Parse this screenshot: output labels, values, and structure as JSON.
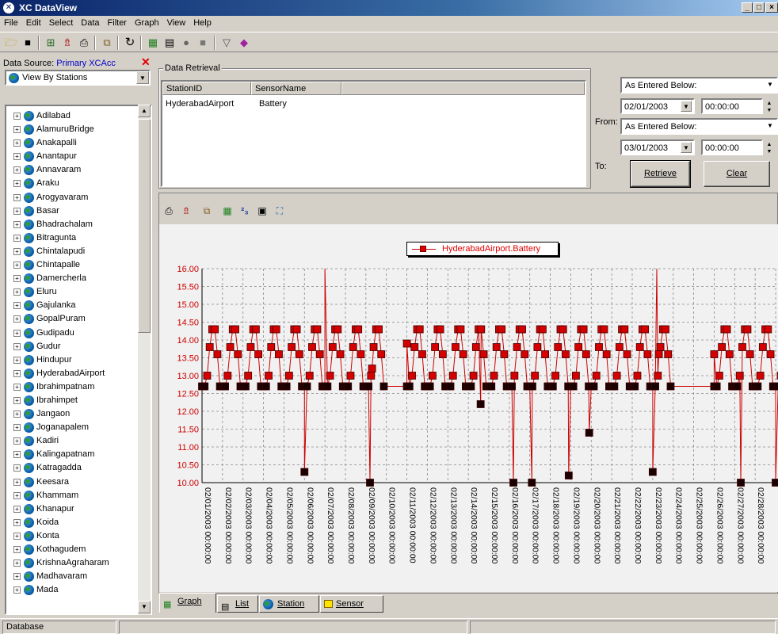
{
  "window": {
    "title": "XC DataView",
    "controls": [
      "_",
      "□",
      "×"
    ]
  },
  "menu": [
    "File",
    "Edit",
    "Select",
    "Data",
    "Filter",
    "Graph",
    "View",
    "Help"
  ],
  "toolbar_icons": [
    "open-folder-icon",
    "save-icon",
    "network-icon",
    "upload-icon",
    "print-icon",
    "copy-icon",
    "refresh-icon",
    "graph-icon",
    "list-icon",
    "record-icon",
    "stop-icon",
    "filter-icon",
    "eraser-icon"
  ],
  "left_panel": {
    "data_source_label": "Data Source:",
    "data_source_value": "Primary XCAcc",
    "view_select": "View By Stations",
    "stations": [
      "Adilabad",
      "AlamuruBridge",
      "Anakapalli",
      "Anantapur",
      "Annavaram",
      "Araku",
      "Arogyavaram",
      "Basar",
      "Bhadrachalam",
      "Bitragunta",
      "Chintalapudi",
      "Chintapalle",
      "Damercherla",
      "Eluru",
      "Gajulanka",
      "GopalPuram",
      "Gudipadu",
      "Gudur",
      "Hindupur",
      "HyderabadAirport",
      "Ibrahimpatnam",
      "Ibrahimpet",
      "Jangaon",
      "Joganapalem",
      "Kadiri",
      "Kalingapatnam",
      "Katragadda",
      "Keesara",
      "Khammam",
      "Khanapur",
      "Koida",
      "Konta",
      "Kothagudem",
      "KrishnaAgraharam",
      "Madhavaram",
      "Mada"
    ]
  },
  "retrieval": {
    "group_label": "Data Retrieval",
    "columns": [
      "StationID",
      "SensorName"
    ],
    "rows": [
      [
        "HyderabadAirport",
        "Battery"
      ]
    ],
    "from_label": "From:",
    "to_label": "To:",
    "from_mode": "As Entered Below:",
    "from_date": "02/01/2003",
    "from_time": "00:00:00",
    "to_mode": "As Entered Below:",
    "to_date": "03/01/2003",
    "to_time": "00:00:00",
    "retrieve_label": "Retrieve",
    "clear_label": "Clear"
  },
  "graph_toolbar_icons": [
    "print-icon",
    "upload-icon",
    "copy-icon",
    "graph-style-icon",
    "number-format-icon",
    "grid-icon",
    "chart-settings-icon"
  ],
  "chart_data": {
    "type": "line",
    "series": [
      {
        "name": "HyderabadAirport.Battery",
        "color": "#cc0000"
      }
    ],
    "legend": "top-center",
    "ylim": [
      10.0,
      16.0
    ],
    "yticks": [
      "16.00",
      "15.50",
      "15.00",
      "14.50",
      "14.00",
      "13.50",
      "13.00",
      "12.50",
      "12.00",
      "11.50",
      "11.00",
      "10.50",
      "10.00"
    ],
    "xticks": [
      "02/01/2003 00:00:00",
      "02/02/2003 00:00:00",
      "02/03/2003 00:00:00",
      "02/04/2003 00:00:00",
      "02/05/2003 00:00:00",
      "02/06/2003 00:00:00",
      "02/07/2003 00:00:00",
      "02/08/2003 00:00:00",
      "02/09/2003 00:00:00",
      "02/10/2003 00:00:00",
      "02/11/2003 00:00:00",
      "02/12/2003 00:00:00",
      "02/13/2003 00:00:00",
      "02/14/2003 00:00:00",
      "02/15/2003 00:00:00",
      "02/16/2003 00:00:00",
      "02/17/2003 00:00:00",
      "02/18/2003 00:00:00",
      "02/19/2003 00:00:00",
      "02/20/2003 00:00:00",
      "02/21/2003 00:00:00",
      "02/22/2003 00:00:00",
      "02/23/2003 00:00:00",
      "02/24/2003 00:00:00",
      "02/25/2003 00:00:00",
      "02/26/2003 00:00:00",
      "02/27/2003 00:00:00",
      "02/28/2003 00:00:00",
      "03/01/2003 00:00:00"
    ],
    "grid": true,
    "days_with_data": [
      0,
      1,
      2,
      3,
      4,
      5,
      6,
      7,
      8,
      10,
      11,
      12,
      13,
      14,
      15,
      16,
      17,
      18,
      19,
      20,
      21,
      22,
      25,
      26,
      27,
      28
    ],
    "daily_cycle": [
      12.7,
      13.0,
      13.8,
      14.3,
      13.6,
      12.7
    ],
    "gaps": [
      [
        8.3,
        10.0,
        13.2,
        13.9
      ],
      [
        22.3,
        25.0,
        13.6,
        13.6
      ]
    ],
    "spikes_down": [
      [
        5.0,
        10.3
      ],
      [
        8.2,
        10.0
      ],
      [
        15.2,
        10.0
      ],
      [
        16.1,
        10.0
      ],
      [
        17.9,
        10.2
      ],
      [
        18.9,
        11.4
      ],
      [
        22.0,
        10.3
      ],
      [
        26.3,
        10.0
      ],
      [
        28.0,
        10.0
      ],
      [
        13.6,
        12.2
      ]
    ],
    "spikes_up": [
      [
        6.0,
        16.0
      ],
      [
        22.2,
        16.0
      ]
    ]
  },
  "tabs": [
    "Graph",
    "List",
    "Station",
    "Sensor"
  ],
  "status": {
    "pane1": "Database",
    "pane2": "",
    "pane3": ""
  }
}
